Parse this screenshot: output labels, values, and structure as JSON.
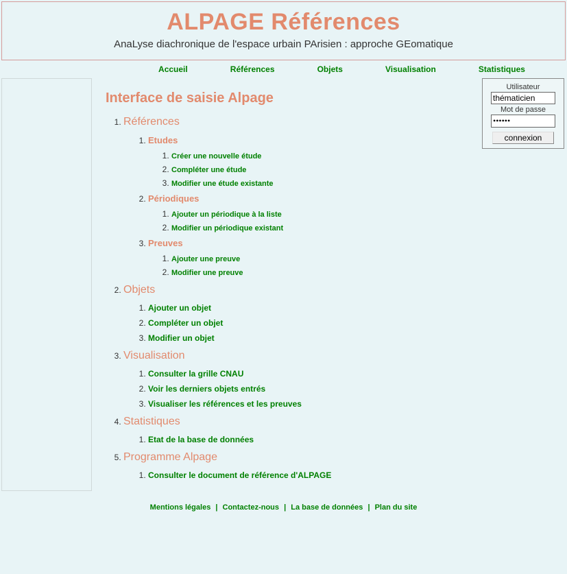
{
  "header": {
    "title": "ALPAGE Références",
    "subtitle": "AnaLyse diachronique de l'espace urbain PArisien : approche GEomatique"
  },
  "topnav": [
    "Accueil",
    "Références",
    "Objets",
    "Visualisation",
    "Statistiques"
  ],
  "page_title": "Interface de saisie Alpage",
  "login": {
    "user_label": "Utilisateur",
    "user_value": "thématicien",
    "pass_label": "Mot de passe",
    "pass_value": "******",
    "button": "connexion"
  },
  "sections": [
    {
      "label": "Références",
      "items": [
        {
          "label": "Etudes",
          "items": [
            {
              "label": "Créer une nouvelle étude"
            },
            {
              "label": "Compléter une étude"
            },
            {
              "label": "Modifier une étude existante"
            }
          ]
        },
        {
          "label": "Périodiques",
          "items": [
            {
              "label": "Ajouter un périodique à la liste"
            },
            {
              "label": "Modifier un périodique existant"
            }
          ]
        },
        {
          "label": "Preuves",
          "items": [
            {
              "label": "Ajouter une preuve"
            },
            {
              "label": "Modifier une preuve"
            }
          ]
        }
      ]
    },
    {
      "label": "Objets",
      "links": [
        {
          "label": "Ajouter un objet"
        },
        {
          "label": "Compléter un objet"
        },
        {
          "label": "Modifier un objet"
        }
      ]
    },
    {
      "label": "Visualisation",
      "links": [
        {
          "label": "Consulter la grille CNAU"
        },
        {
          "label": "Voir les derniers objets entrés"
        },
        {
          "label": "Visualiser les références et les preuves"
        }
      ]
    },
    {
      "label": "Statistiques",
      "links": [
        {
          "label": "Etat de la base de données"
        }
      ]
    },
    {
      "label": "Programme Alpage",
      "links": [
        {
          "label": "Consulter le document de référence d'ALPAGE"
        }
      ]
    }
  ],
  "footer": [
    "Mentions légales",
    "Contactez-nous",
    "La base de données",
    "Plan du site"
  ]
}
